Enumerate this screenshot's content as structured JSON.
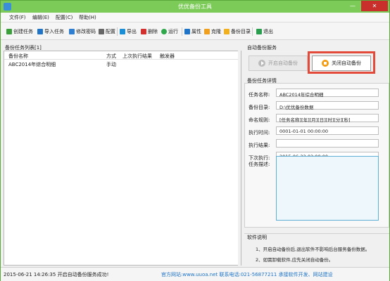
{
  "window": {
    "title": "优优备份工具",
    "minimize": "—",
    "close": "✕"
  },
  "menu": [
    {
      "label": "文件(F)"
    },
    {
      "label": "编辑(E)"
    },
    {
      "label": "配置(C)"
    },
    {
      "label": "帮助(H)"
    }
  ],
  "toolbar": {
    "items": [
      {
        "label": "创建任务",
        "icon": "plus-icon",
        "color": "#3aa03a"
      },
      {
        "label": "导入任务",
        "icon": "import-icon",
        "color": "#1f74c8"
      },
      {
        "label": "修改密码",
        "icon": "key-icon",
        "color": "#2f7ecf"
      },
      {
        "label": "配置",
        "icon": "gear-icon",
        "color": "#666666"
      },
      {
        "label": "导出",
        "icon": "export-icon",
        "color": "#1c8ed6"
      },
      {
        "label": "删除",
        "icon": "delete-icon",
        "color": "#d33030"
      },
      {
        "label": "运行",
        "icon": "play-icon",
        "color": "#2ea84a"
      },
      {
        "label": "属性",
        "icon": "properties-icon",
        "color": "#1f74c8"
      },
      {
        "label": "克隆",
        "icon": "clone-icon",
        "color": "#f0a020"
      },
      {
        "label": "备份目录",
        "icon": "folder-icon",
        "color": "#f0b020"
      },
      {
        "label": "退出",
        "icon": "exit-icon",
        "color": "#2a9d4e"
      }
    ]
  },
  "left_panel": {
    "title": "备份任务列表[1]",
    "columns": [
      "备份名称",
      "方式",
      "上次执行结果",
      "触发器"
    ],
    "rows": [
      {
        "name": "ABC2014年综合明细",
        "mode": "手动",
        "last_result": "",
        "trigger": ""
      }
    ]
  },
  "service": {
    "title": "自动备份服务",
    "start_label": "开启自动备份",
    "stop_label": "关闭自动备份"
  },
  "details": {
    "title": "备份任务详情",
    "fields": [
      {
        "label": "任务名称:",
        "value": "ABC2014年综合明细"
      },
      {
        "label": "备份目录:",
        "value": "D:\\优优备份数据"
      },
      {
        "label": "命名规则:",
        "value": "[任务名称][年][月][日][时][分][秒]"
      },
      {
        "label": "执行时间:",
        "value": "0001-01-01 00:00:00"
      },
      {
        "label": "执行结果:",
        "value": ""
      },
      {
        "label": "下次执行:",
        "value": "2015-06-22 02:00:00"
      }
    ],
    "description_label": "任务描述:"
  },
  "software_info": {
    "title": "软件说明",
    "lines": [
      "1、开启自动备份后,退出软件不影响后台服务备份数据。",
      "2、如需卸载软件,应先关闭自动备份。"
    ]
  },
  "status": {
    "left": "2015-06-21 14:26:35 开启自动备份服务成功!",
    "right": "官方网站:www.uuoa.net 联系电话:021-56877211 承接软件开发、网站建设"
  }
}
